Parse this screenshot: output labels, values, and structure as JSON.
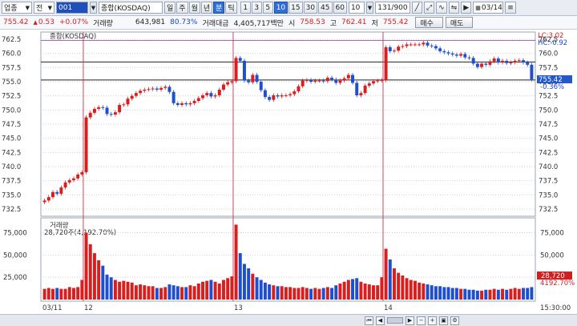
{
  "toolbar": {
    "category": "업종",
    "market": "전",
    "code": "001",
    "name": "종합(KOSDAQ)",
    "periods": [
      "일",
      "주",
      "월",
      "년",
      "분",
      "틱"
    ],
    "active_period": "분",
    "intervals": [
      "1",
      "3",
      "5",
      "10",
      "15",
      "30",
      "45",
      "60"
    ],
    "active_interval": "10",
    "interval_select": "10",
    "count": "131/900",
    "date": "03/14"
  },
  "quote": {
    "price": "755.42",
    "change": "0.53",
    "change_pct": "+0.07%",
    "volume_label": "거래량",
    "volume": "643,981",
    "volume_pct": "80.73%",
    "amount_label": "거래대금",
    "amount": "4,405,717백만",
    "open_label": "시",
    "open": "758.53",
    "high_label": "고",
    "high": "762.41",
    "low_label": "저",
    "low": "755.42",
    "buy_label": "매수",
    "sell_label": "매도"
  },
  "price_panel": {
    "title": "종합(KOSDAQ)",
    "lc": "LC:3.02",
    "hc": "HC:-0.92",
    "last_pct": "-0.36%",
    "last_price": "755.42"
  },
  "volume_panel": {
    "title": "거래량",
    "subtitle": "28,720주(4,192.70%)",
    "last_value": "28,720",
    "last_pct": "4192.70%",
    "time_label": "15:30:00"
  },
  "chart_data": [
    {
      "type": "candlestick",
      "title": "종합(KOSDAQ)",
      "ylim": [
        731.5,
        763.5
      ],
      "y_ticks": [
        762.5,
        760.0,
        757.5,
        755.0,
        752.5,
        750.0,
        747.5,
        745.0,
        742.5,
        740.0,
        737.5,
        735.0,
        732.5
      ],
      "x_labels": [
        "03/11",
        "12",
        "13",
        "14"
      ],
      "reference_lines": [
        758.5,
        755.3
      ],
      "session_lines": [
        762.3
      ],
      "closes": [
        734.0,
        734.6,
        735.5,
        735.2,
        736.3,
        737.2,
        737.6,
        737.9,
        738.6,
        739.0,
        748.7,
        749.5,
        750.2,
        750.5,
        750.4,
        749.3,
        749.2,
        749.6,
        750.9,
        751.0,
        752.0,
        752.5,
        753.0,
        753.4,
        753.6,
        753.7,
        753.8,
        753.6,
        753.9,
        754.1,
        753.2,
        751.2,
        750.9,
        751.2,
        751.0,
        751.2,
        751.6,
        752.1,
        752.6,
        753.0,
        752.4,
        752.6,
        753.6,
        754.5,
        754.9,
        755.1,
        759.2,
        758.7,
        755.2,
        754.9,
        756.2,
        755.0,
        753.5,
        752.3,
        751.8,
        752.6,
        752.4,
        752.6,
        752.6,
        752.8,
        753.3,
        754.2,
        755.2,
        755.3,
        755.0,
        755.2,
        755.2,
        755.1,
        755.7,
        755.4,
        754.8,
        755.2,
        755.6,
        756.2,
        754.8,
        752.6,
        753.0,
        754.3,
        754.7,
        755.1,
        755.2,
        755.3,
        761.1,
        760.4,
        760.5,
        761.2,
        761.3,
        761.6,
        761.6,
        761.6,
        761.6,
        761.9,
        761.4,
        761.3,
        760.9,
        760.4,
        760.2,
        760.0,
        759.8,
        759.6,
        759.9,
        759.3,
        759.2,
        758.2,
        757.6,
        758.2,
        758.0,
        758.6,
        759.1,
        758.4,
        758.7,
        758.3,
        758.4,
        758.7,
        758.8,
        758.4,
        758.0,
        755.4
      ]
    },
    {
      "type": "bar",
      "title": "거래량",
      "ylim": [
        0,
        88000
      ],
      "y_ticks": [
        75000,
        50000,
        25000
      ],
      "values": [
        12000,
        13000,
        12000,
        13000,
        12000,
        12000,
        14000,
        13000,
        14000,
        22000,
        75000,
        62000,
        52000,
        44000,
        38000,
        28000,
        25000,
        22000,
        20000,
        21000,
        20000,
        19000,
        16000,
        17000,
        16000,
        15000,
        15000,
        13000,
        13000,
        14000,
        17000,
        16000,
        15000,
        14000,
        14000,
        16000,
        15000,
        18000,
        20000,
        21000,
        22000,
        20000,
        18000,
        22000,
        24000,
        26000,
        84000,
        52000,
        40000,
        35000,
        29000,
        25000,
        22000,
        19000,
        17000,
        16000,
        15000,
        15000,
        14000,
        14000,
        13000,
        13000,
        14000,
        13000,
        12000,
        13000,
        12000,
        13000,
        14000,
        13000,
        16000,
        18000,
        20000,
        22000,
        23000,
        24000,
        20000,
        18000,
        17000,
        16000,
        16000,
        25000,
        57000,
        45000,
        35000,
        30000,
        27000,
        24000,
        22000,
        21000,
        19000,
        18000,
        17000,
        16000,
        15000,
        15000,
        14000,
        14000,
        13000,
        13000,
        12000,
        12000,
        11000,
        11000,
        10000,
        10000,
        11000,
        11000,
        12000,
        11000,
        12000,
        11000,
        12000,
        13000,
        12000,
        13000,
        13000,
        14000,
        24000,
        28720
      ]
    }
  ]
}
